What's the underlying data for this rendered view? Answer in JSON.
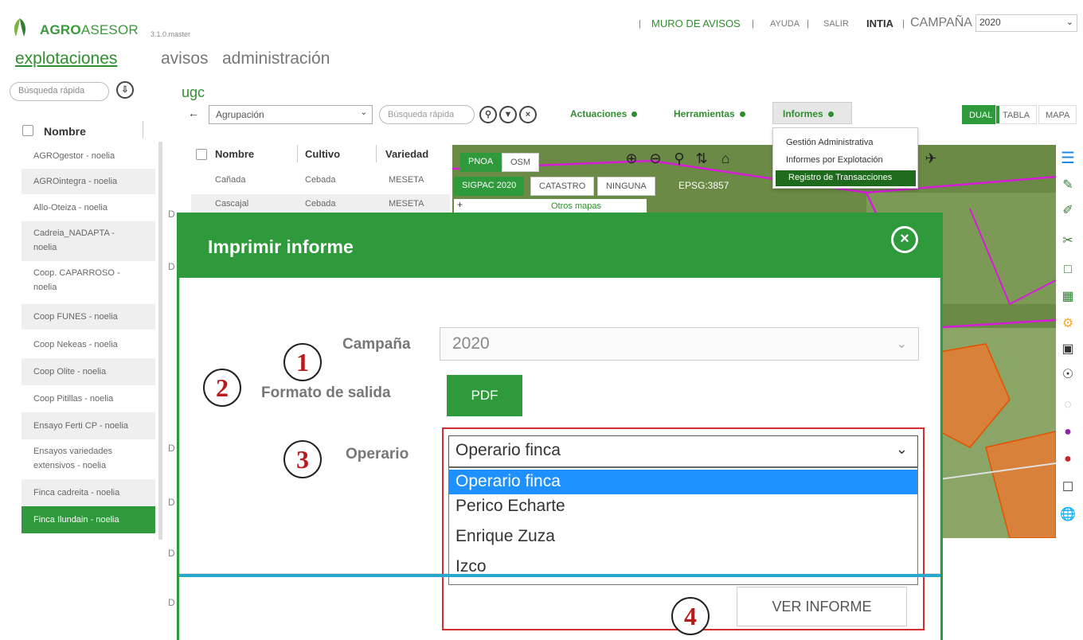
{
  "header": {
    "logo_bold": "AGRO",
    "logo_thin": "ASESOR",
    "version": "3.1.0.master",
    "muro": "MURO DE AVISOS",
    "ayuda": "AYUDA",
    "salir": "SALIR",
    "user": "INTIA",
    "campaign_label": "CAMPAÑA",
    "campaign_value": "2020",
    "sep": "|"
  },
  "nav": {
    "explotaciones": "explotaciones",
    "avisos": "avisos",
    "administracion": "administración"
  },
  "left": {
    "search_placeholder": "Búsqueda rápida",
    "header": "Nombre",
    "items": [
      "AGROgestor - noelia",
      "AGROintegra - noelia",
      "Allo-Oteiza - noelia",
      "Cadreia_NADAPTA -",
      "noelia",
      "Coop. CAPARROSO -",
      "noelia",
      "Coop FUNES - noelia",
      "Coop Nekeas - noelia",
      "Coop Olite - noelia",
      "Coop Pitillas - noelia",
      "Ensayo Ferti CP - noelia",
      "Ensayos variedades",
      "extensivos - noelia",
      "Finca cadreita - noelia",
      "Finca Ilundain - noelia"
    ]
  },
  "toolbar": {
    "group_title": "ugc",
    "agrupacion": "Agrupación",
    "search_placeholder": "Búsqueda rápida",
    "actuaciones": "Actuaciones",
    "herramientas": "Herramientas",
    "informes": "Informes",
    "dual": "DUAL",
    "tabla": "TABLA",
    "mapa": "MAPA"
  },
  "informes_menu": {
    "items": [
      "Gestión Administrativa",
      "Informes por Explotación",
      "Registro de Transacciones"
    ]
  },
  "table": {
    "headers": [
      "Nombre",
      "Cultivo",
      "Variedad"
    ],
    "rows": [
      [
        "Cañada",
        "Cebada",
        "MESETA"
      ],
      [
        "Cascajal",
        "Cebada",
        "MESETA"
      ]
    ]
  },
  "map": {
    "pnoa": "PNOA",
    "osm": "OSM",
    "sigpac": "SIGPAC 2020",
    "catastro": "CATASTRO",
    "ninguna": "NINGUNA",
    "epsg": "EPSG:3857",
    "otros": "Otros mapas",
    "plus": "+"
  },
  "modal": {
    "title": "Imprimir informe",
    "close": "⊗",
    "campana_label": "Campaña",
    "campana_value": "2020",
    "formato_label": "Formato de salida",
    "pdf": "PDF",
    "operario_label": "Operario",
    "operario_value": "Operario finca",
    "operario_options": [
      "Operario finca",
      "Perico Echarte",
      "Enrique Zuza",
      "Izco"
    ],
    "ver_informe": "VER INFORME"
  },
  "callouts": [
    "1",
    "2",
    "3",
    "4"
  ],
  "colors": {
    "brand_green": "#2e9a3b",
    "dark_green": "#1e6b1e",
    "selection_blue": "#1e90ff",
    "highlight_red": "#d32f2f",
    "teal": "#29a9c9"
  }
}
